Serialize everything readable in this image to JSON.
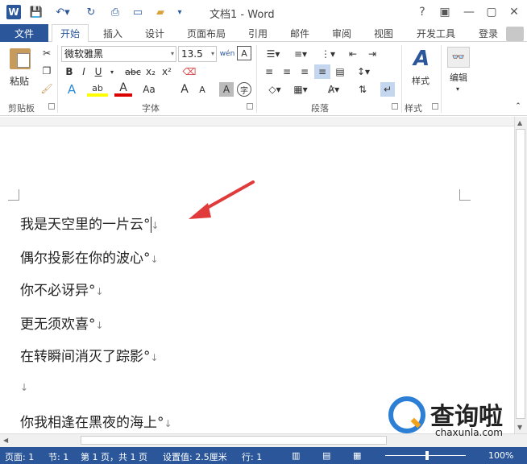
{
  "window": {
    "title": "文档1 - Word",
    "help": "?",
    "controls": [
      "?",
      "▣",
      "—",
      "▢",
      "✕"
    ]
  },
  "tabs": {
    "file": "文件",
    "items": [
      "开始",
      "插入",
      "设计",
      "页面布局",
      "引用",
      "邮件",
      "审阅",
      "视图",
      "开发工具"
    ],
    "active": "开始",
    "login": "登录"
  },
  "ribbon": {
    "clipboard": {
      "paste": "粘贴",
      "group": "剪贴板"
    },
    "font": {
      "name": "微软雅黑",
      "size": "13.5",
      "group": "字体",
      "bold": "B",
      "italic": "I",
      "underline": "U",
      "strike": "abc",
      "sub": "x₂",
      "sup": "x²",
      "grow": "A",
      "shrink": "A",
      "case": "Aa",
      "wen": "wén"
    },
    "paragraph": {
      "group": "段落"
    },
    "styles": {
      "label": "样式",
      "group": "样式"
    },
    "editing": {
      "label": "编辑"
    }
  },
  "document": {
    "lines": [
      "我是天空里的一片云°",
      "偶尔投影在你的波心°",
      "你不必讶异°",
      "更无须欢喜°",
      "在转瞬间消灭了踪影°",
      "",
      "你我相逢在黑夜的海上°"
    ],
    "para_mark": "↓"
  },
  "status": {
    "page": "页面: 1",
    "section": "节: 1",
    "pages": "第 1 页，共 1 页",
    "setting": "设置值: 2.5厘米",
    "row": "行: 1",
    "zoom": "100%"
  },
  "watermark": {
    "text": "查询啦",
    "url": "chaxunla.com"
  },
  "colors": {
    "accent": "#2b579a",
    "annotation_arrow": "#e03a3a"
  }
}
